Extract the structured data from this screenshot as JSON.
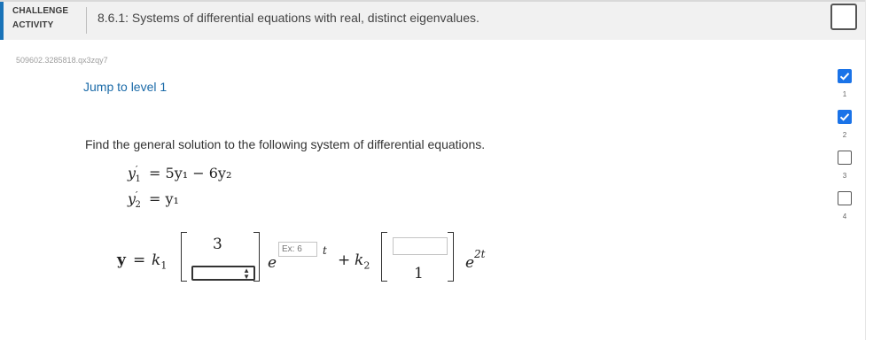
{
  "header": {
    "activity_type": "CHALLENGE ACTIVITY",
    "title": "8.6.1: Systems of differential equations with real, distinct eigenvalues."
  },
  "content_id": "509602.3285818.qx3zqy7",
  "jump_link": "Jump to level 1",
  "question": {
    "prompt": "Find the general solution to the following system of differential equations.",
    "eq1": {
      "lhs": "y",
      "lhs_sub": "1",
      "rhs": "= 5y₁ − 6y₂"
    },
    "eq2": {
      "lhs": "y",
      "lhs_sub": "2",
      "rhs": "= y₁"
    }
  },
  "answer": {
    "y_label": "y",
    "equals": "=",
    "k1": "k",
    "k1_sub": "1",
    "vec1_top": "3",
    "vec1_bottom_value": "",
    "e1": "e",
    "exp1_placeholder": "Ex: 6",
    "exp1_suffix": "t",
    "plus": "+",
    "k2": "k",
    "k2_sub": "2",
    "vec2_top_value": "",
    "vec2_bottom": "1",
    "e2": "e",
    "exp2": "2t"
  },
  "levels": [
    {
      "number": "1",
      "state": "complete"
    },
    {
      "number": "2",
      "state": "complete"
    },
    {
      "number": "3",
      "state": "incomplete"
    },
    {
      "number": "4",
      "state": "incomplete"
    }
  ],
  "colors": {
    "accent": "#1a73b8",
    "level_complete": "#1a73e8",
    "link": "#1a6aa8"
  }
}
